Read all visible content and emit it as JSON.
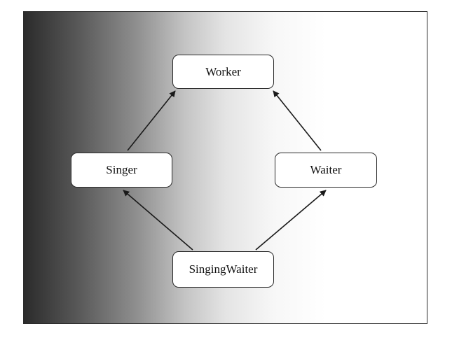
{
  "diagram": {
    "nodes": [
      {
        "id": "worker",
        "label": "Worker"
      },
      {
        "id": "singer",
        "label": "Singer"
      },
      {
        "id": "waiter",
        "label": "Waiter"
      },
      {
        "id": "singingwaiter",
        "label": "SingingWaiter"
      }
    ],
    "edges": [
      {
        "from": "singer",
        "to": "worker"
      },
      {
        "from": "waiter",
        "to": "worker"
      },
      {
        "from": "singingwaiter",
        "to": "singer"
      },
      {
        "from": "singingwaiter",
        "to": "waiter"
      }
    ]
  }
}
